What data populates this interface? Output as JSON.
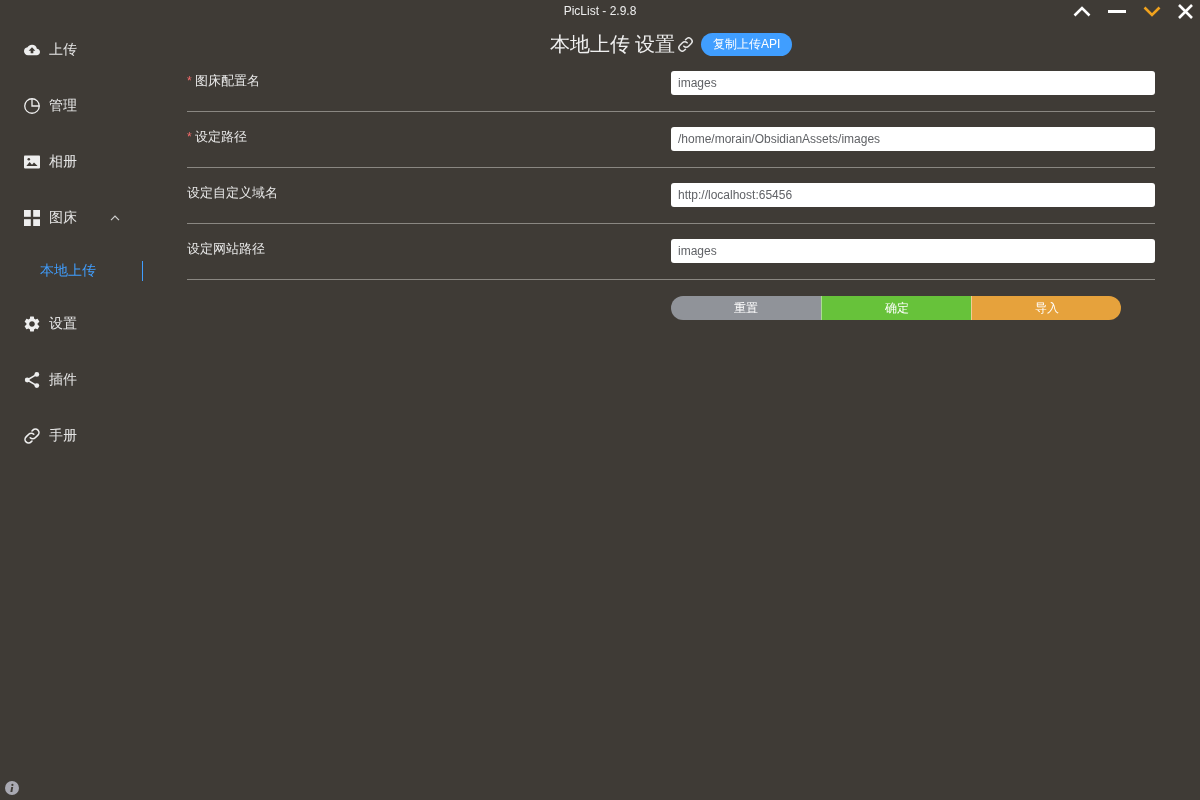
{
  "window": {
    "title": "PicList - 2.9.8"
  },
  "sidebar": {
    "items": [
      {
        "label": "上传",
        "selected": false
      },
      {
        "label": "管理",
        "selected": false
      },
      {
        "label": "相册",
        "selected": false
      },
      {
        "label": "图床",
        "selected": false,
        "expanded": true,
        "children": [
          {
            "label": "本地上传",
            "selected": true
          }
        ]
      },
      {
        "label": "设置",
        "selected": false
      },
      {
        "label": "插件",
        "selected": false
      },
      {
        "label": "手册",
        "selected": false
      }
    ]
  },
  "header": {
    "title": "本地上传 设置",
    "api_button": "复制上传API"
  },
  "form": {
    "fields": [
      {
        "label": "图床配置名",
        "required_mark": "*",
        "value": "images"
      },
      {
        "label": "设定路径",
        "required_mark": "*",
        "value": "/home/morain/ObsidianAssets/images"
      },
      {
        "label": "设定自定义域名",
        "value": "http://localhost:65456"
      },
      {
        "label": "设定网站路径",
        "value": "images"
      }
    ],
    "buttons": [
      {
        "label": "重置",
        "kind": "reset"
      },
      {
        "label": "确定",
        "kind": "confirm"
      },
      {
        "label": "导入",
        "kind": "import"
      }
    ]
  }
}
